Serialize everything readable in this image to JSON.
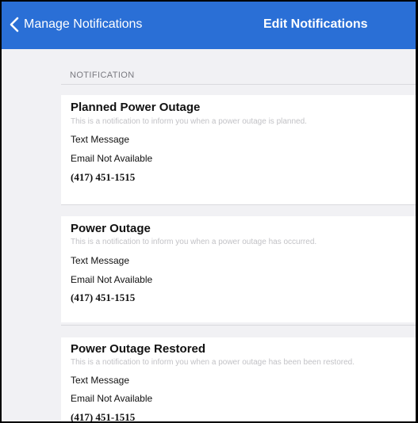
{
  "navbar": {
    "back_label": "Manage Notifications",
    "title": "Edit Notifications"
  },
  "section_header": "NOTIFICATION",
  "notifications": [
    {
      "title": "Planned Power Outage",
      "description": "This is a notification to inform you when a power outage is planned.",
      "text_message": "Text Message",
      "email": "Email Not Available",
      "phone": "(417) 451-1515"
    },
    {
      "title": "Power Outage",
      "description": "This is a notification to inform you when a power outage has occurred.",
      "text_message": "Text Message",
      "email": "Email Not Available",
      "phone": "(417) 451-1515"
    },
    {
      "title": "Power Outage Restored",
      "description": "This is a notification to inform you when a power outage has been been restored.",
      "text_message": "Text Message",
      "email": "Email Not Available",
      "phone": "(417) 451-1515"
    }
  ],
  "colors": {
    "navbar": "#2a6fd6",
    "background": "#f1f1f4",
    "card": "#ffffff",
    "description_text": "#c2c2c6"
  },
  "icons": {
    "back": "chevron-left-icon"
  }
}
